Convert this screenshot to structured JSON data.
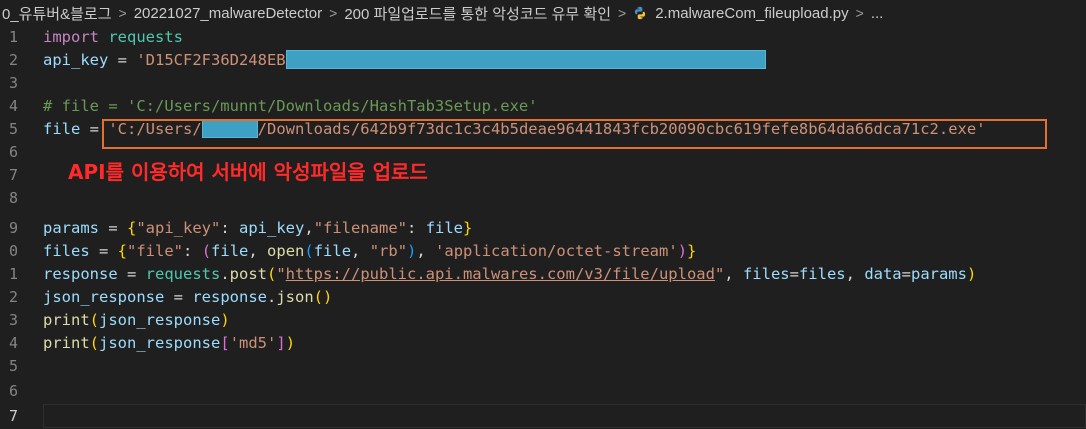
{
  "breadcrumb": {
    "items": [
      "0_유튜버&블로그",
      "20221027_malwareDetector",
      "200 파일업로드를 통한 악성코드 유무 확인",
      "2.malwareCom_fileupload.py",
      "..."
    ],
    "separator": ">"
  },
  "line_numbers": [
    "1",
    "2",
    "3",
    "4",
    "5",
    "6",
    "7",
    "8",
    "9",
    "0",
    "1",
    "2",
    "3",
    "4",
    "5",
    "6",
    "7"
  ],
  "code": {
    "l1_import": "import",
    "l1_module": "requests",
    "l2_var": "api_key",
    "l2_eq": " = ",
    "l2_str": "'D15CF2F36D248EB",
    "l4_comment": "# file = 'C:/Users/munnt/Downloads/HashTab3Setup.exe'",
    "l5_var": "file",
    "l5_eq": " = ",
    "l5_str_a": "'C:/Users/",
    "l5_str_b": "/Downloads/642b9f73dc1c3c4b5deae96441843fcb20090cbc619fefe8b64da66dca71c2.exe'",
    "l9_params": "params",
    "l9_eq": " = ",
    "l9_k1": "\"api_key\"",
    "l9_colon1": ": ",
    "l9_v1": "api_key",
    "l9_comma": ",",
    "l9_k2": "\"filename\"",
    "l9_colon2": ": ",
    "l9_v2": "file",
    "l10_files": "files",
    "l10_eq": " = ",
    "l10_k": "\"file\"",
    "l10_colon": ": ",
    "l10_file": "file",
    "l10_comma1": ", ",
    "l10_open": "open",
    "l10_file2": "file",
    "l10_comma2": ", ",
    "l10_rb": "\"rb\"",
    "l10_comma3": ", ",
    "l10_mime": "'application/octet-stream'",
    "l11_resp": "response",
    "l11_eq": " = ",
    "l11_req": "requests",
    "l11_dot": ".",
    "l11_post": "post",
    "l11_q1": "\"",
    "l11_url": "https://public.api.malwares.com/v3/file/upload",
    "l11_q2": "\"",
    "l11_c1": ", ",
    "l11_files": "files",
    "l11_eq2": "=",
    "l11_files2": "files",
    "l11_c2": ", ",
    "l11_data": "data",
    "l11_eq3": "=",
    "l11_params": "params",
    "l12_json": "json_response",
    "l12_eq": " = ",
    "l12_resp": "response",
    "l12_dot": ".",
    "l12_fn": "json",
    "l13_print": "print",
    "l13_arg": "json_response",
    "l14_print": "print",
    "l14_arg": "json_response",
    "l14_key": "'md5'"
  },
  "annotation": "API를 이용하여 서버에 악성파일을 업로드",
  "colors": {
    "background": "#1f1f1f",
    "redaction": "#3ea1c4",
    "highlight_border": "#e2702f",
    "annotation": "#ff2a2a"
  }
}
